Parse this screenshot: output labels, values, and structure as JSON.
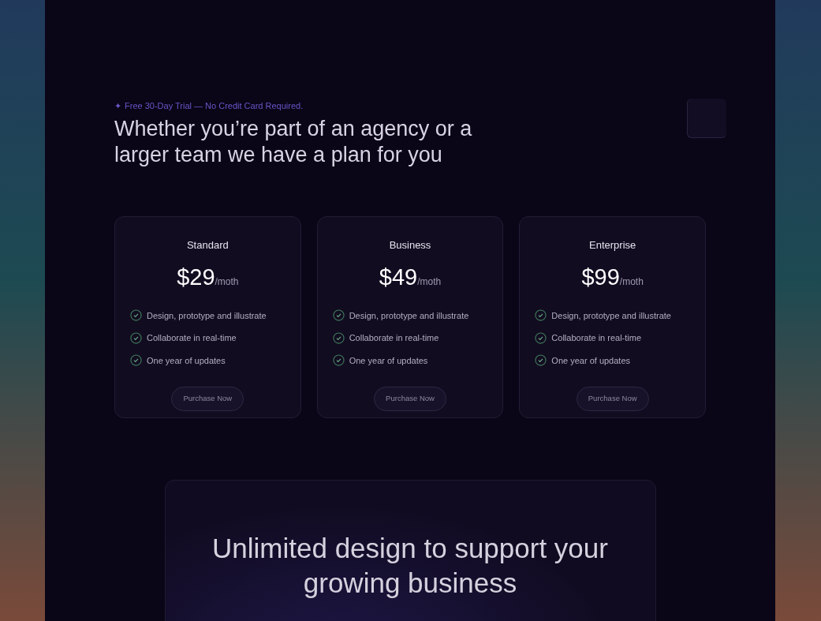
{
  "trial_note": {
    "icon": "✦",
    "text": "Free 30-Day Trial — No Credit Card Required."
  },
  "headline": "Whether you’re part of an agency or a larger team we have a plan for you",
  "plans": [
    {
      "name": "Standard",
      "price": "$29",
      "period": "/moth",
      "features": [
        "Design, prototype and illustrate",
        "Collaborate in real-time",
        "One year of updates"
      ],
      "button": "Purchase Now"
    },
    {
      "name": "Business",
      "price": "$49",
      "period": "/moth",
      "features": [
        "Design, prototype and illustrate",
        "Collaborate in real-time",
        "One year of updates"
      ],
      "button": "Purchase Now"
    },
    {
      "name": "Enterprise",
      "price": "$99",
      "period": "/moth",
      "features": [
        "Design, prototype and illustrate",
        "Collaborate in real-time",
        "One year of updates"
      ],
      "button": "Purchase Now"
    }
  ],
  "banner": {
    "headline": "Unlimited design to support your growing business"
  }
}
